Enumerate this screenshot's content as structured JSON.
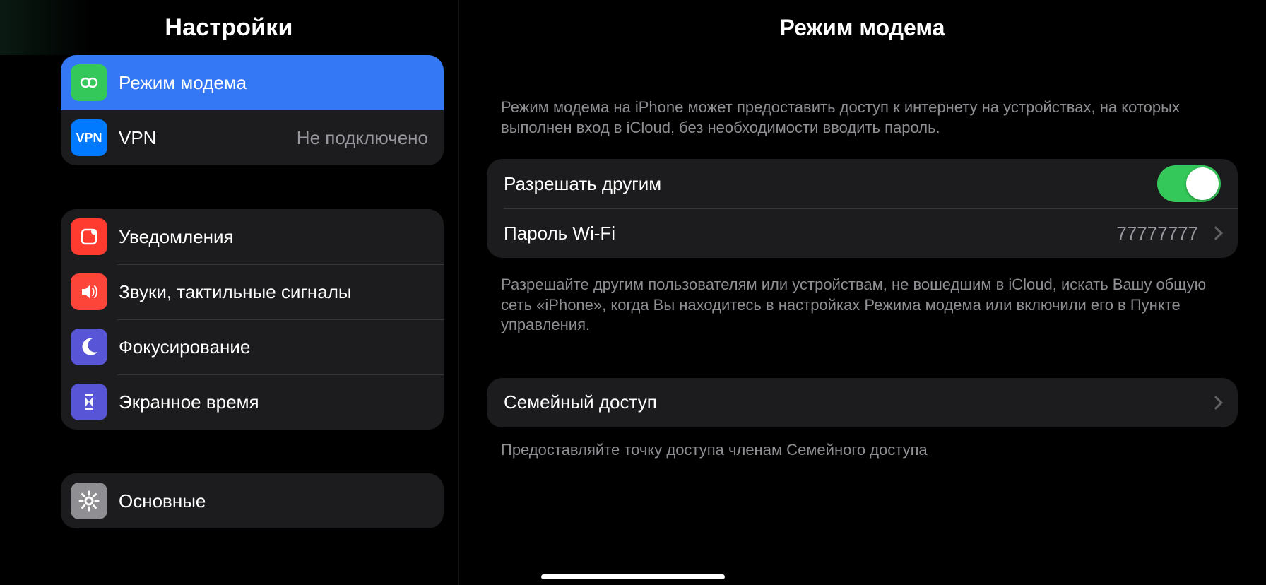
{
  "sidebar": {
    "title": "Настройки",
    "group1": {
      "hotspot": {
        "label": "Режим модема"
      },
      "vpn": {
        "label": "VPN",
        "value": "Не подключено"
      }
    },
    "group2": {
      "notifications": {
        "label": "Уведомления"
      },
      "sounds": {
        "label": "Звуки, тактильные сигналы"
      },
      "focus": {
        "label": "Фокусирование"
      },
      "screentime": {
        "label": "Экранное время"
      }
    },
    "group3": {
      "general": {
        "label": "Основные"
      }
    }
  },
  "detail": {
    "title": "Режим модема",
    "intro": "Режим модема на iPhone может предоставить доступ к интернету на устройствах, на которых выполнен вход в iCloud, без необходимости вводить пароль.",
    "allow_others": {
      "label": "Разрешать другим",
      "on": true
    },
    "wifi_password": {
      "label": "Пароль Wi-Fi",
      "value": "77777777"
    },
    "explain": "Разрешайте другим пользователям или устройствам, не вошедшим в iCloud, искать Вашу общую сеть «iPhone», когда Вы находитесь в настройках Режима модема или включили его в Пункте управления.",
    "family": {
      "label": "Семейный доступ"
    },
    "family_footnote": "Предоставляйте точку доступа членам Семейного доступа"
  }
}
